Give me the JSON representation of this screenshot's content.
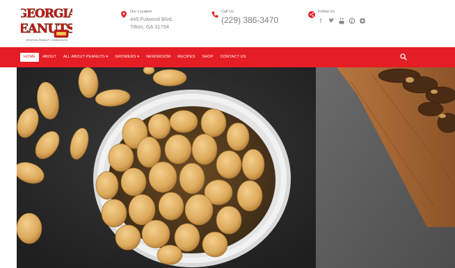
{
  "header": {
    "logo": {
      "name": "GEORGIA PEANUTS",
      "tagline": "GEORGIA PEANUT COMMISSION"
    },
    "address": {
      "label": "Our Location",
      "line1": "445 Fulwood Blvd.",
      "line2": "Tifton, GA 31794"
    },
    "call": {
      "label": "Call Us",
      "phone": "(229) 386-3470"
    },
    "follow": {
      "label": "Follow Us",
      "icons": [
        "facebook-icon",
        "twitter-icon",
        "youtube-icon",
        "pinterest-icon",
        "instagram-icon"
      ]
    }
  },
  "nav": {
    "items": [
      {
        "label": "HOME",
        "active": true
      },
      {
        "label": "ABOUT"
      },
      {
        "label": "ALL ABOUT PEANUTS ▾"
      },
      {
        "label": "GROWERS ▾"
      },
      {
        "label": "NEWSROOM"
      },
      {
        "label": "RECIPES"
      },
      {
        "label": "SHOP"
      },
      {
        "label": "CONTACT US"
      }
    ],
    "search_icon": "search-icon"
  },
  "colors": {
    "brand_red": "#e51d24",
    "logo_red": "#c8161d",
    "text_gray": "#888888"
  }
}
